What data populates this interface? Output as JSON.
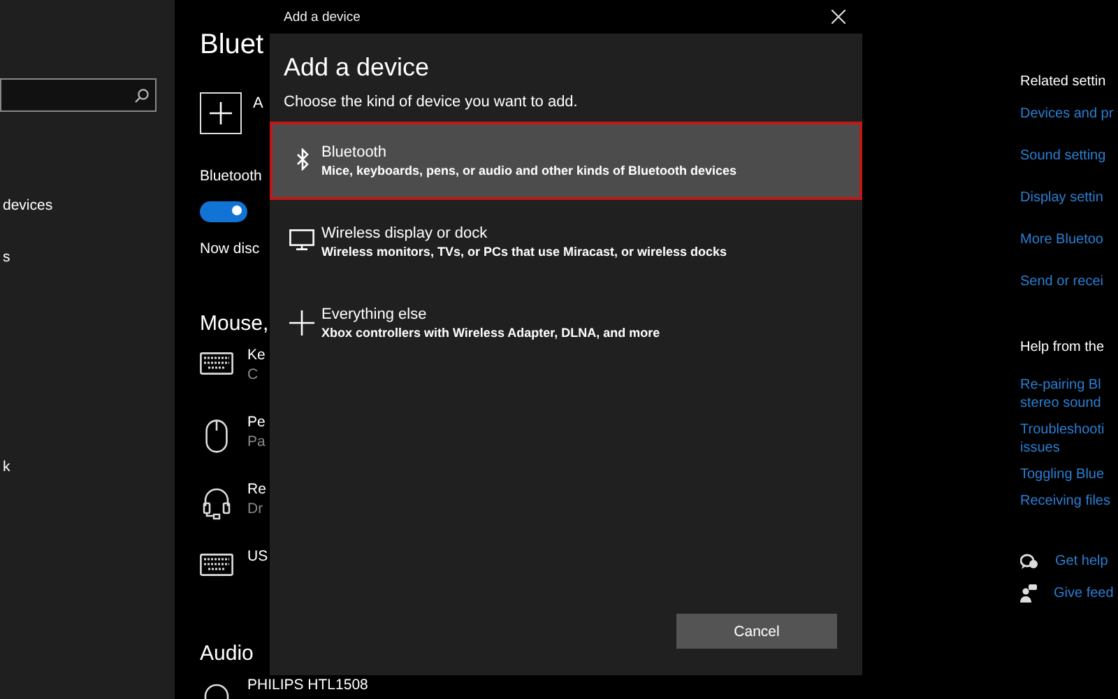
{
  "sidebar": {
    "items": [
      {
        "label": "devices"
      },
      {
        "label": "s"
      },
      {
        "label": "k"
      }
    ]
  },
  "main": {
    "title": "Bluet",
    "add_label": "A",
    "bluetooth_label": "Bluetooth",
    "toggle": {
      "on": true
    },
    "discover": "Now disc",
    "mouse_heading": "Mouse,",
    "devices": [
      {
        "kind": "keyboard",
        "name": "Ke",
        "status": "C"
      },
      {
        "kind": "mouse",
        "name": "Pe",
        "status": "Pa"
      },
      {
        "kind": "headset",
        "name": "Re",
        "status": "Dr"
      },
      {
        "kind": "keyboard",
        "name": "US"
      }
    ],
    "audio_heading": "Audio",
    "audio_device": "PHILIPS HTL1508"
  },
  "dialog": {
    "window_title": "Add a device",
    "heading": "Add a device",
    "subtitle": "Choose the kind of device you want to add.",
    "options": [
      {
        "kind": "bluetooth",
        "title": "Bluetooth",
        "description": "Mice, keyboards, pens, or audio and other kinds of Bluetooth devices",
        "selected": true
      },
      {
        "kind": "display",
        "title": "Wireless display or dock",
        "description": "Wireless monitors, TVs, or PCs that use Miracast, or wireless docks",
        "selected": false
      },
      {
        "kind": "other",
        "title": "Everything else",
        "description": "Xbox controllers with Wireless Adapter, DLNA, and more",
        "selected": false
      }
    ],
    "cancel": "Cancel"
  },
  "related": {
    "heading": "Related settin",
    "links": [
      [
        "Devices and pr"
      ],
      [
        "Sound setting"
      ],
      [
        "Display settin"
      ],
      [
        "More Bluetoo"
      ],
      [
        "Send or recei"
      ]
    ]
  },
  "help": {
    "heading": "Help from the",
    "links": [
      [
        "Re-pairing Bl",
        "stereo sound"
      ],
      [
        "Troubleshooti",
        "issues"
      ],
      [
        "Toggling Blue"
      ],
      [
        "Receiving files"
      ]
    ]
  },
  "footer_links": [
    {
      "kind": "help",
      "label": "Get help"
    },
    {
      "kind": "feedback",
      "label": "Give feed"
    }
  ]
}
